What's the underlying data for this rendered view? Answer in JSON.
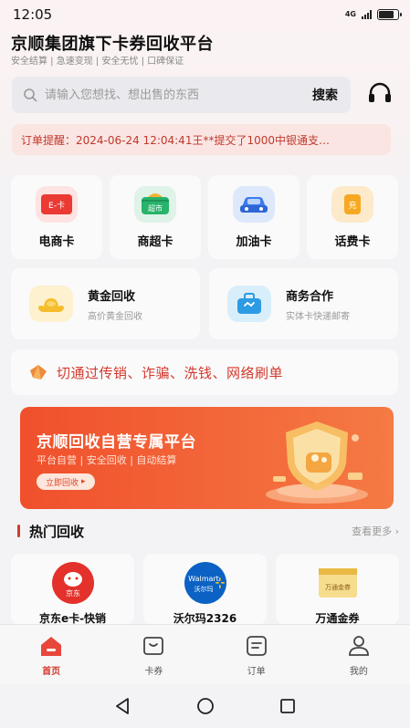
{
  "status_bar": {
    "time": "12:05",
    "network": "4G"
  },
  "app_title": "京顺集团旗下卡券回收平台",
  "tags": "安全结算 | 急速变现 | 安全无忧 | 口碑保证",
  "search": {
    "placeholder": "请输入您想找、想出售的东西",
    "button_label": "搜索"
  },
  "order_notice": "订单提醒：2024-06-24 12:04:41王**提交了1000中银通支…",
  "categories": [
    {
      "label": "电商卡",
      "icon": "e-card-icon",
      "badge": "E-卡"
    },
    {
      "label": "商超卡",
      "icon": "supermarket-icon",
      "badge": "超市"
    },
    {
      "label": "加油卡",
      "icon": "car-icon"
    },
    {
      "label": "话费卡",
      "icon": "phone-bill-icon",
      "badge": "充"
    }
  ],
  "services": [
    {
      "title": "黄金回收",
      "subtitle": "高价黄金回收",
      "icon": "gold-ingot-icon"
    },
    {
      "title": "商务合作",
      "subtitle": "实体卡快递邮寄",
      "icon": "briefcase-icon"
    }
  ],
  "warning": "切通过传销、诈骗、洗钱、网络刷单",
  "banner": {
    "title": "京顺回收自营专属平台",
    "subtitle": "平台自营 | 安全回收 | 自动结算",
    "button_label": "立即回收"
  },
  "hot_section": {
    "title": "热门回收",
    "more_label": "查看更多",
    "items": [
      {
        "name": "京东e卡-快销",
        "logo": "jd-logo",
        "logo_text": "京东"
      },
      {
        "name": "沃尔玛2326",
        "logo": "walmart-logo",
        "logo_text": "Walmart",
        "logo_sub": "沃尔玛"
      },
      {
        "name": "万通金券",
        "logo": "wantong-logo",
        "logo_text": "万通金券"
      }
    ]
  },
  "tab_bar": [
    {
      "label": "首页",
      "icon": "home-icon",
      "active": true
    },
    {
      "label": "卡券",
      "icon": "card-voucher-icon",
      "active": false
    },
    {
      "label": "订单",
      "icon": "order-icon",
      "active": false
    },
    {
      "label": "我的",
      "icon": "profile-icon",
      "active": false
    }
  ],
  "colors": {
    "accent": "#d23a2e",
    "banner": "#f0502c",
    "notice_bg": "#fae5e3"
  }
}
